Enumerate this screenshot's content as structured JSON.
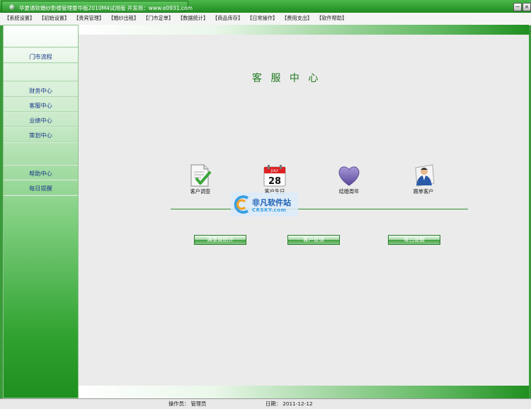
{
  "window": {
    "title": "华夏通软婚纱影楼管理豪华版2010M4试用版   开发商：www.e0931.com",
    "minimize_glyph": "−",
    "close_glyph": "×"
  },
  "menu": [
    "【系统设置】",
    "【初始设置】",
    "【贵宾管理】",
    "【婚纱出租】",
    "【门市定单】",
    "【数据统计】",
    "【商品库存】",
    "【日常操作】",
    "【费用支出】",
    "【软件帮助】"
  ],
  "sidebar": {
    "items": [
      "门市流程",
      "财务中心",
      "客服中心",
      "业绩中心",
      "策划中心",
      "帮助中心",
      "每日提醒"
    ]
  },
  "main": {
    "heading": "客 服 中 心",
    "features": [
      {
        "label": "客户调查",
        "icon": "survey-icon"
      },
      {
        "label": "客户生日",
        "icon": "calendar-icon",
        "calendar_month": "JULY",
        "calendar_day": "28"
      },
      {
        "label": "结婚周年",
        "icon": "heart-icon"
      },
      {
        "label": "跟单客户",
        "icon": "customer-icon"
      }
    ],
    "buttons": [
      "满意度统计",
      "客户反馈",
      "每日提醒"
    ]
  },
  "watermark": {
    "line1": "非凡软件站",
    "line2": "CRSKY.com"
  },
  "status": {
    "operator": "操作员： 管理员",
    "date": "日期： 2011-12-12"
  },
  "colors": {
    "accent_green": "#1f8f1f",
    "link_blue": "#1a3a8a"
  }
}
